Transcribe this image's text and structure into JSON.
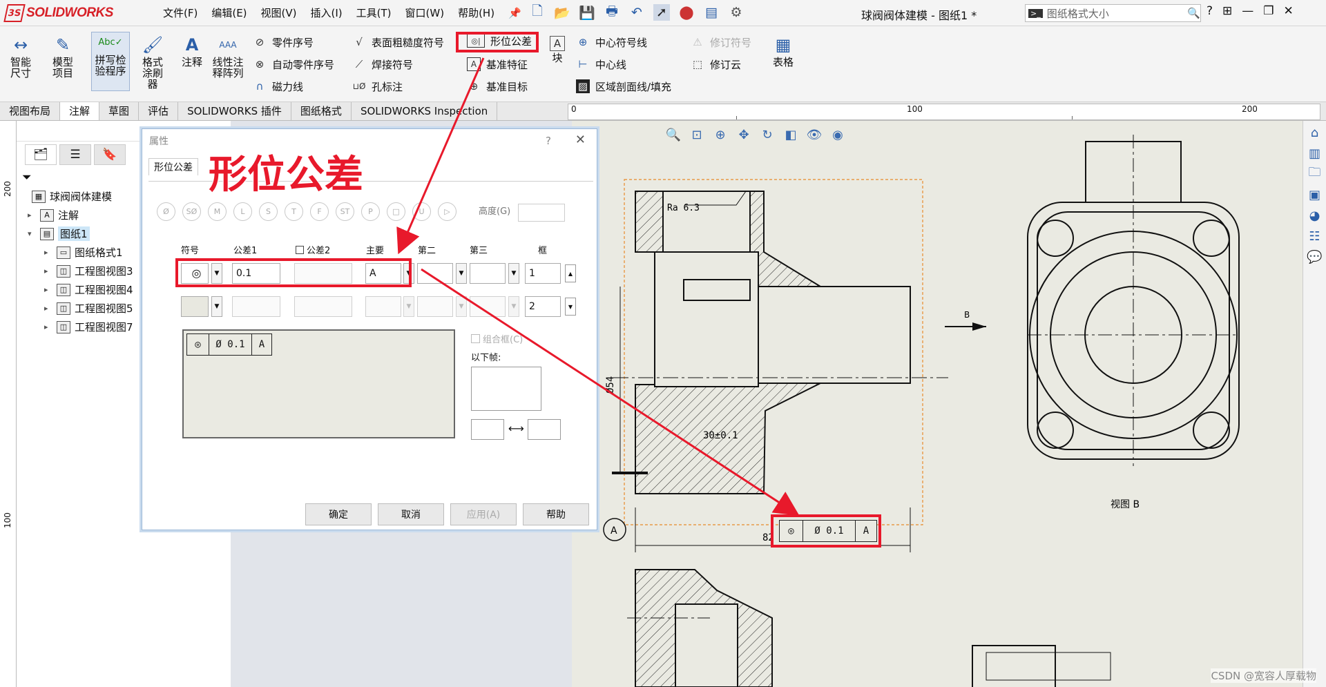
{
  "app": {
    "logo_mark": "3S",
    "logo_text": "SOLIDWORKS",
    "doc_title": "球阀阀体建模 - 图纸1 *",
    "search_placeholder": "图纸格式大小"
  },
  "menu": [
    "文件(F)",
    "编辑(E)",
    "视图(V)",
    "插入(I)",
    "工具(T)",
    "窗口(W)",
    "帮助(H)"
  ],
  "ribbon": {
    "smart_dim": "智能尺寸",
    "model_items": "模型项目",
    "spell_check": "拼写检验程序",
    "format_painter": "格式涂刷器",
    "note": "注释",
    "linear_note": "线性注释阵列",
    "balloon": "零件序号",
    "auto_balloon": "自动零件序号",
    "magnetic_line": "磁力线",
    "surface_finish": "表面粗糙度符号",
    "weld_symbol": "焊接符号",
    "hole_callout": "孔标注",
    "gtol": "形位公差",
    "datum_feature": "基准特征",
    "datum_target": "基准目标",
    "block": "块",
    "center_mark": "中心符号线",
    "centerline": "中心线",
    "area_hatch": "区域剖面线/填充",
    "revision_symbol": "修订符号",
    "revision_cloud": "修订云",
    "table": "表格"
  },
  "tabs": [
    "视图布局",
    "注解",
    "草图",
    "评估",
    "SOLIDWORKS 插件",
    "图纸格式",
    "SOLIDWORKS Inspection"
  ],
  "active_tab": 1,
  "ruler": {
    "h": [
      "0",
      "100",
      "200"
    ],
    "v": [
      "200",
      "100"
    ]
  },
  "tree": {
    "root": "球阀阀体建模",
    "notes": "注解",
    "sheet": "图纸1",
    "children": [
      "图纸格式1",
      "工程图视图3",
      "工程图视图4",
      "工程图视图5",
      "工程图视图7"
    ]
  },
  "dialog": {
    "title": "属性",
    "tab": "形位公差",
    "symbols": [
      "Ø",
      "SØ",
      "M",
      "L",
      "S",
      "T",
      "F",
      "ST",
      "P",
      "□",
      "U",
      "▷"
    ],
    "height_label": "高度(G)",
    "col_symbol": "符号",
    "col_tol1": "公差1",
    "col_tol2": "公差2",
    "col_primary": "主要",
    "col_second": "第二",
    "col_third": "第三",
    "col_frame": "框",
    "row1": {
      "tol1": "0.1",
      "primary": "A",
      "frame": "1"
    },
    "row2": {
      "frame": "2"
    },
    "preview": {
      "symbol": "◎",
      "tol": "Ø  0.1",
      "datum": "A"
    },
    "composite": "组合框(C)",
    "below": "以下帧:",
    "buttons": {
      "ok": "确定",
      "cancel": "取消",
      "apply": "应用(A)",
      "help": "帮助"
    }
  },
  "annotation_title": "形位公差",
  "drawing": {
    "ra": "Ra 6.3",
    "dim_54": "Ø54",
    "dim_30": "30±0.1",
    "dim_82": "82",
    "datum": "A",
    "view_b_arrow": "B",
    "view_b_label": "视图 B",
    "fcf": {
      "symbol": "◎",
      "tol": "Ø  0.1",
      "datum": "A"
    }
  },
  "watermark": "CSDN @宽容人厚载物"
}
